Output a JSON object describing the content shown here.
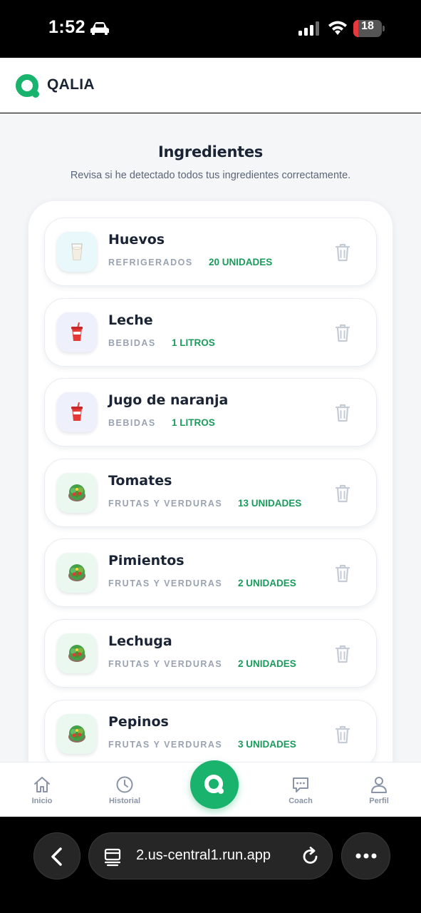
{
  "status_bar": {
    "time": "1:52",
    "battery_level": "18",
    "battery_fraction": 0.18,
    "battery_color": "#e5393c",
    "icons": [
      "car-icon",
      "signal-icon",
      "wifi-icon",
      "battery-icon"
    ]
  },
  "header": {
    "brand": "QALIA",
    "brand_color": "#19b36e"
  },
  "page": {
    "title": "Ingredientes",
    "subtitle": "Revisa si he detectado todos tus ingredientes correctamente."
  },
  "ingredients": [
    {
      "name": "Huevos",
      "category": "REFRIGERADOS",
      "quantity": "20 UNIDADES",
      "icon": "milk-glass-icon",
      "icon_bg": "#e8f8fb"
    },
    {
      "name": "Leche",
      "category": "BEBIDAS",
      "quantity": "1 LITROS",
      "icon": "soda-cup-icon",
      "icon_bg": "#eef0fb"
    },
    {
      "name": "Jugo de naranja",
      "category": "BEBIDAS",
      "quantity": "1 LITROS",
      "icon": "soda-cup-icon",
      "icon_bg": "#eef0fb"
    },
    {
      "name": "Tomates",
      "category": "FRUTAS Y VERDURAS",
      "quantity": "13 UNIDADES",
      "icon": "salad-icon",
      "icon_bg": "#eaf8f0"
    },
    {
      "name": "Pimientos",
      "category": "FRUTAS Y VERDURAS",
      "quantity": "2 UNIDADES",
      "icon": "salad-icon",
      "icon_bg": "#eaf8f0"
    },
    {
      "name": "Lechuga",
      "category": "FRUTAS Y VERDURAS",
      "quantity": "2 UNIDADES",
      "icon": "salad-icon",
      "icon_bg": "#eaf8f0"
    },
    {
      "name": "Pepinos",
      "category": "FRUTAS Y VERDURAS",
      "quantity": "3 UNIDADES",
      "icon": "salad-icon",
      "icon_bg": "#eaf8f0"
    }
  ],
  "colors": {
    "accent": "#19b36e",
    "quantity_text": "#1a9b5c"
  },
  "bottom_nav": {
    "items": [
      {
        "label": "Inicio",
        "icon": "home-icon"
      },
      {
        "label": "Historial",
        "icon": "clock-icon"
      },
      {
        "label": "Coach",
        "icon": "chat-icon"
      },
      {
        "label": "Perfil",
        "icon": "user-icon"
      }
    ],
    "center_icon": "qalia-logo-icon"
  },
  "browser": {
    "url": "2.us-central1.run.app",
    "icons": [
      "back-arrow-icon",
      "tabs-icon",
      "reload-icon",
      "more-icon"
    ]
  }
}
